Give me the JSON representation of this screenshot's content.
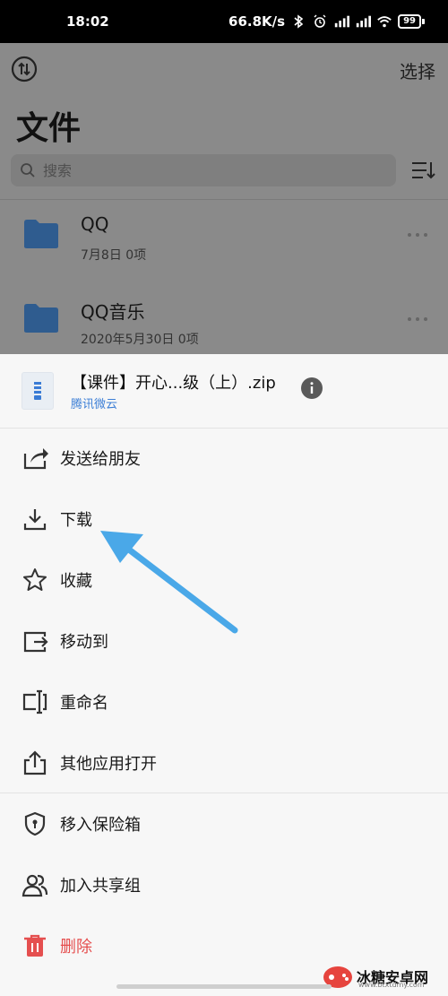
{
  "status": {
    "time": "18:02",
    "speed": "66.8K/s",
    "battery": "99"
  },
  "header": {
    "select_label": "选择",
    "title": "文件"
  },
  "search": {
    "placeholder": "搜索"
  },
  "folders": [
    {
      "name": "QQ",
      "meta": "7月8日  0项"
    },
    {
      "name": "QQ音乐",
      "meta": "2020年5月30日  0项"
    }
  ],
  "sheet": {
    "file_name": "【课件】开心...级（上）.zip",
    "file_source": "腾讯微云",
    "actions": [
      {
        "label": "发送给朋友",
        "icon": "share-icon"
      },
      {
        "label": "下载",
        "icon": "download-icon"
      },
      {
        "label": "收藏",
        "icon": "star-icon"
      },
      {
        "label": "移动到",
        "icon": "move-icon"
      },
      {
        "label": "重命名",
        "icon": "rename-icon"
      },
      {
        "label": "其他应用打开",
        "icon": "open-with-icon"
      },
      {
        "label": "移入保险箱",
        "icon": "shield-icon"
      },
      {
        "label": "加入共享组",
        "icon": "group-icon"
      },
      {
        "label": "删除",
        "icon": "trash-icon"
      }
    ]
  },
  "watermark": {
    "text": "冰糖安卓网",
    "url": "www.btxtdmy.com"
  },
  "colors": {
    "accent_blue": "#3d7fd6",
    "danger_red": "#e54f4f",
    "arrow_blue": "#4aa8e8",
    "folder_blue": "#2f5c8f"
  }
}
